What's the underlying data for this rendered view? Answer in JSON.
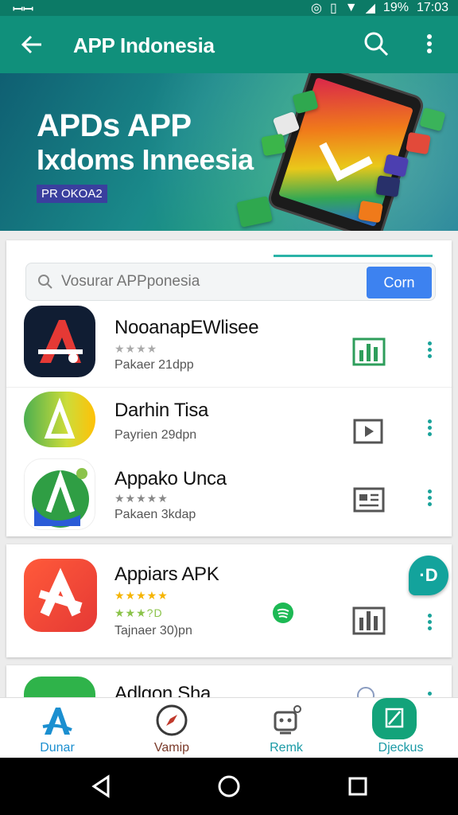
{
  "status_bar": {
    "left": "ꟷꟷ",
    "icons": [
      "alarm-icon",
      "vibrate-icon",
      "wifi-icon",
      "signal-icon"
    ],
    "battery": "19%",
    "time": "17:03"
  },
  "appbar": {
    "title": "APP Indonesia"
  },
  "banner": {
    "line1": "APDs APP",
    "line2": "Ixdoms Inneesia",
    "tag": "PR OKOA2"
  },
  "search": {
    "placeholder": "Vosurar APPponesia",
    "button": "Corn"
  },
  "apps": [
    {
      "name": "NooanapEWlisee",
      "stars": "★★★★",
      "meta": "Pakaer 21dpp",
      "action_icon": "chart-icon"
    },
    {
      "name": "Darhin Tisa",
      "stars": "",
      "meta": "Payrien 29dpn",
      "action_icon": "play-icon"
    },
    {
      "name": "Appako Unca",
      "stars": "★★★★★",
      "meta": "Pakaen 3kdap",
      "action_icon": "news-icon"
    },
    {
      "name": "Appiars APK",
      "stars": "★★★★★",
      "stars2": "★★★?D",
      "meta": "Tajnaer 30)pn",
      "action_icon": "chart-icon",
      "badge_icon": "spotify-icon"
    },
    {
      "name": "Adlgon Sha",
      "stars": "",
      "meta": "",
      "action_icon": "globe-icon"
    }
  ],
  "fab": {
    "label": "·D"
  },
  "bottom_nav": [
    {
      "label": "Dunar",
      "icon": "a-logo-icon",
      "color": "#1b8fd0"
    },
    {
      "label": "Vamip",
      "icon": "compass-icon",
      "color": "#7a3a2a"
    },
    {
      "label": "Remk",
      "icon": "robot-icon",
      "color": "#1a9aa6"
    },
    {
      "label": "Djeckus",
      "icon": "edit-icon",
      "color": "#1a9aa6"
    }
  ],
  "colors": {
    "primary": "#10907b",
    "primary_dark": "#0c7a66",
    "accent": "#3d82f0",
    "kebab": "#1aa39a"
  }
}
